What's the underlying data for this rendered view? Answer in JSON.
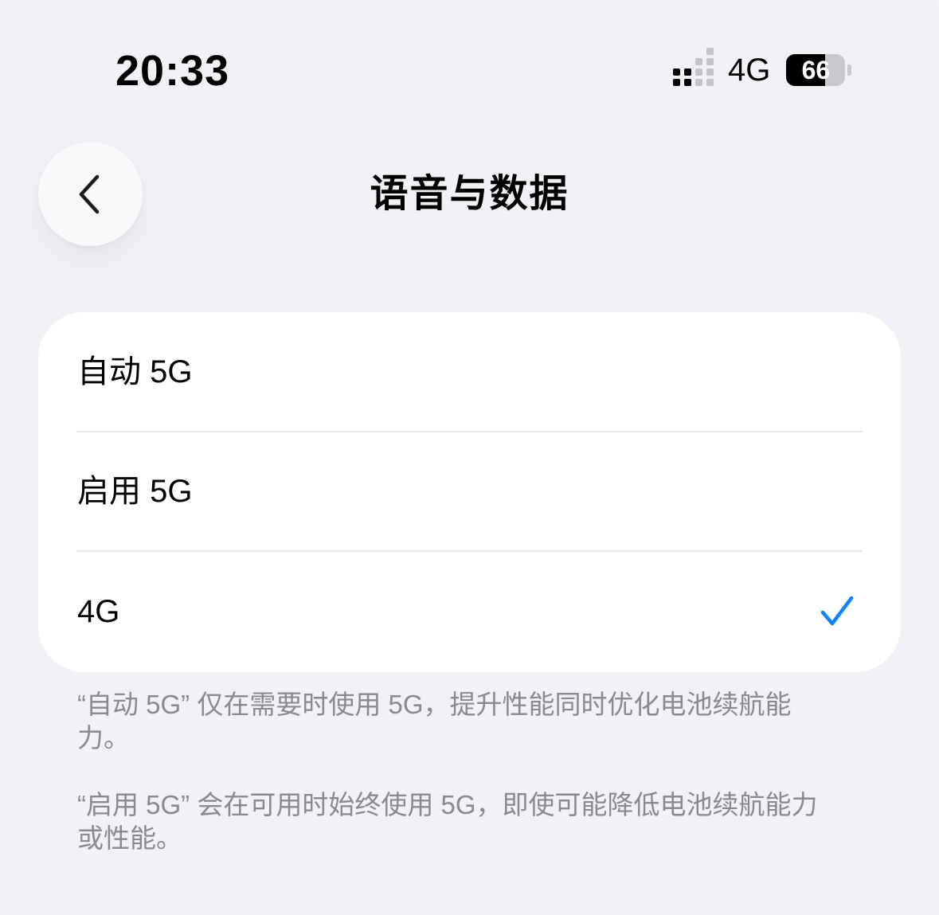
{
  "status_bar": {
    "time": "20:33",
    "network": "4G",
    "battery_percent": "66",
    "battery_level": 0.66,
    "signal_bars": 2,
    "signal_icon": "cellular-signal-icon",
    "battery_icon": "battery-icon"
  },
  "nav": {
    "back_icon": "chevron-left-icon",
    "title": "语音与数据"
  },
  "options": [
    {
      "label": "自动 5G",
      "selected": false
    },
    {
      "label": "启用 5G",
      "selected": false
    },
    {
      "label": "4G",
      "selected": true
    }
  ],
  "accent_color": "#0a84ff",
  "check_icon": "checkmark-icon",
  "footnotes": [
    "“自动 5G” 仅在需要时使用 5G，提升性能同时优化电池续航能力。",
    "“启用 5G” 会在可用时始终使用 5G，即使可能降低电池续航能力或性能。"
  ]
}
